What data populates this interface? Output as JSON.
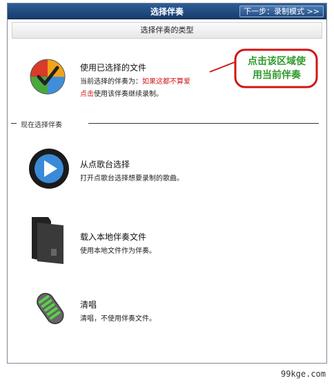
{
  "window": {
    "title": "选择伴奏",
    "next_button": "下一步：录制模式 >>"
  },
  "subheader": "选择伴奏的类型",
  "options": [
    {
      "title": "使用已选择的文件",
      "desc_prefix": "当前选择的伴奏为：",
      "desc_highlight": "如果这都不算爱",
      "desc_link": "点击",
      "desc_suffix": "使用该伴奏继续录制。",
      "icon": "checkmark-badge-icon"
    },
    {
      "title": "从点歌台选择",
      "desc": "打开点歌台选择想要录制的歌曲。",
      "icon": "play-button-icon"
    },
    {
      "title": "载入本地伴奏文件",
      "desc": "使用本地文件作为伴奏。",
      "icon": "folder-icon"
    },
    {
      "title": "清唱",
      "desc": "清唱，不使用伴奏文件。",
      "icon": "microphone-icon"
    }
  ],
  "section_label": "现在选择伴奏",
  "callout": {
    "line1": "点击该区域使",
    "line2": "用当前伴奏"
  },
  "watermark": "99kge.com",
  "colors": {
    "titlebar": "#1f4a7f",
    "highlight_red": "#d01616",
    "callout_green": "#2f9a2c"
  }
}
